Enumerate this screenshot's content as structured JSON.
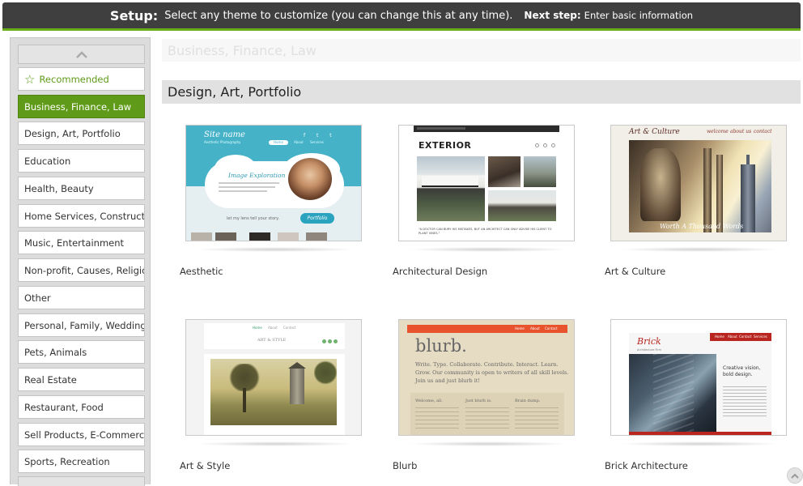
{
  "header": {
    "setup_label": "Setup:",
    "message": "Select any theme to customize (you can change this at any time).",
    "next_label": "Next step:",
    "next_value": "Enter basic information"
  },
  "sidebar": {
    "items": [
      {
        "label": "Recommended"
      },
      {
        "label": "Business, Finance, Law"
      },
      {
        "label": "Design, Art, Portfolio"
      },
      {
        "label": "Education"
      },
      {
        "label": "Health, Beauty"
      },
      {
        "label": "Home Services, Construction"
      },
      {
        "label": "Music, Entertainment"
      },
      {
        "label": "Non-profit, Causes, Religion"
      },
      {
        "label": "Other"
      },
      {
        "label": "Personal, Family, Wedding"
      },
      {
        "label": "Pets, Animals"
      },
      {
        "label": "Real Estate"
      },
      {
        "label": "Restaurant, Food"
      },
      {
        "label": "Sell Products, E-Commerce"
      },
      {
        "label": "Sports, Recreation"
      }
    ]
  },
  "main": {
    "prev_heading": "Business, Finance, Law",
    "section_heading": "Design, Art, Portfolio",
    "themes": [
      {
        "name": "Aesthetic",
        "thumb": {
          "site_name": "Site name",
          "tagline": "Aesthetic Photography",
          "nav_home": "Home",
          "nav_about": "About",
          "nav_services": "Services",
          "headline": "Image Exploration",
          "story": "let my lens tell your story.",
          "cta": "Portfolio"
        }
      },
      {
        "name": "Architectural Design",
        "thumb": {
          "title": "EXTERIOR",
          "quote": "\"A DOCTOR CAN BURY HIS MISTAKES, BUT AN ARCHITECT CAN ONLY ADVISE HIS CLIENT TO PLANT VINES.\""
        }
      },
      {
        "name": "Art & Culture",
        "thumb": {
          "title": "Art & Culture",
          "nav_welcome": "welcome",
          "nav_about": "about us",
          "nav_contact": "contact",
          "caption": "Worth A Thousand Words"
        }
      },
      {
        "name": "Art & Style",
        "thumb": {
          "nav_home": "Home",
          "nav_about": "About",
          "nav_contact": "Contact",
          "title": "ART & STYLE"
        }
      },
      {
        "name": "Blurb",
        "thumb": {
          "nav_home": "Home",
          "nav_about": "About",
          "nav_contact": "Contact",
          "title": "blurb.",
          "text": "Write. Type. Collaborate. Contribute. Interact. Learn. Grow. Our community is open to writers of all skill levels. Join us and just blurb it!",
          "col1": "Welcome, all.",
          "col2": "Just blurb is.",
          "col3": "Brain dump."
        }
      },
      {
        "name": "Brick Architecture",
        "thumb": {
          "logo": "Brick",
          "sub": "Architecture Firm",
          "nav_home": "Home",
          "nav_about": "About",
          "nav_contact": "Contact",
          "nav_services": "Services",
          "vision": "Creative vision, bold design."
        }
      }
    ]
  },
  "colors": {
    "accent_green": "#5f9b18",
    "header_bg": "#3f3f3f"
  }
}
